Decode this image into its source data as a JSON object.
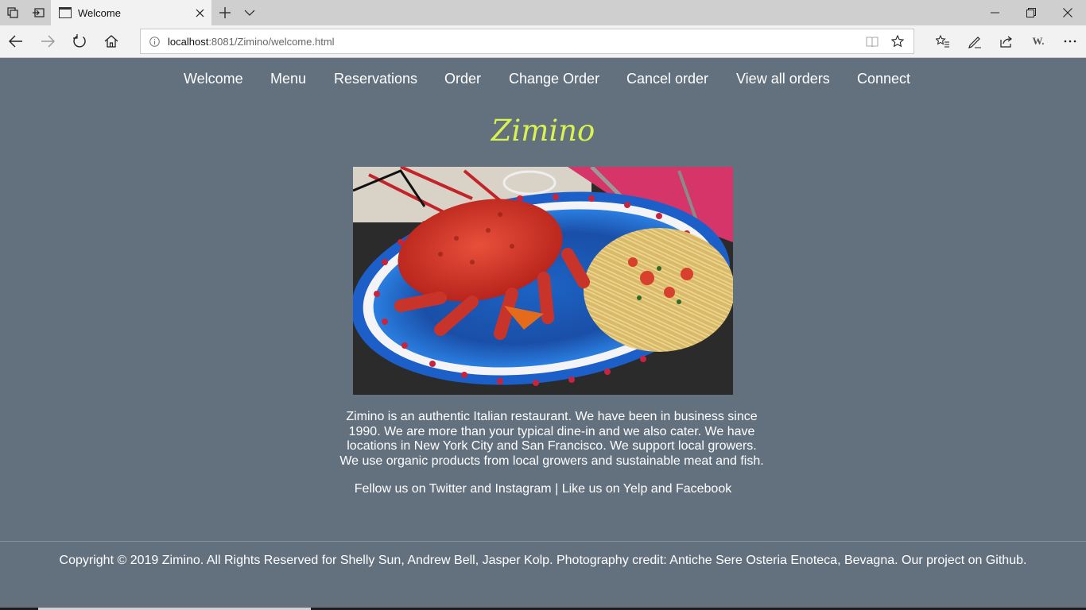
{
  "browser": {
    "tab_title": "Welcome",
    "url_host": "localhost",
    "url_rest": ":8081/Zimino/welcome.html",
    "ext_label": "W."
  },
  "nav": {
    "items": [
      "Welcome",
      "Menu",
      "Reservations",
      "Order",
      "Change Order",
      "Cancel order",
      "View all orders",
      "Connect"
    ]
  },
  "brand": {
    "name": "Zimino",
    "color": "#d8f24e"
  },
  "intro": "Zimino is an authentic Italian restaurant. We have been in business since 1990. We are more than your typical dine-in and we also cater. We have locations in New York City and San Francisco. We support local growers. We use organic products from local growers and sustainable meat and fish.",
  "social": {
    "follow_prefix": "Fellow us on",
    "twitter": "Twitter",
    "and1": "and",
    "instagram": "Instagram",
    "sep": "|",
    "like_prefix": "Like us on",
    "yelp": "Yelp",
    "and2": "and",
    "facebook": "Facebook"
  },
  "footer": {
    "text": "Copyright © 2019 Zimino. All Rights Reserved for Shelly Sun, Andrew Bell, Jasper Kolp. Photography credit: Antiche Sere Osteria Enoteca, Bevagna.",
    "project_prefix": "Our project on",
    "github": "Github",
    "end": "."
  },
  "colors": {
    "page_bg": "#63717f",
    "chrome": "#f2f2f2",
    "tabbar": "#cfcfcf"
  }
}
